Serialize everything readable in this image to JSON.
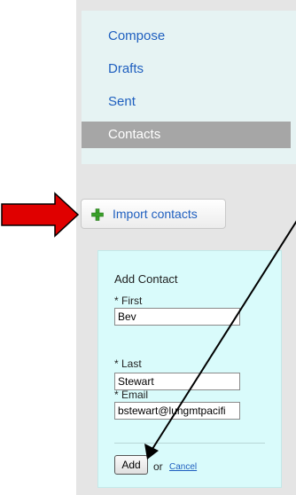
{
  "nav": {
    "items": [
      {
        "label": "Compose"
      },
      {
        "label": "Drafts"
      },
      {
        "label": "Sent"
      },
      {
        "label": "Contacts",
        "active": true
      }
    ]
  },
  "import_button": {
    "label": "Import contacts",
    "icon": "plus-icon"
  },
  "add_contact": {
    "title": "Add Contact",
    "first_label": "* First",
    "first_value": "Bev",
    "last_label": "* Last",
    "last_value": "Stewart",
    "email_label": "* Email",
    "email_value": "bstewart@lungmtpacifi",
    "add_label": "Add",
    "or_text": "or",
    "cancel_label": "Cancel"
  },
  "annotations": {
    "arrow_color": "#e00000",
    "pointer_color": "#000000"
  }
}
